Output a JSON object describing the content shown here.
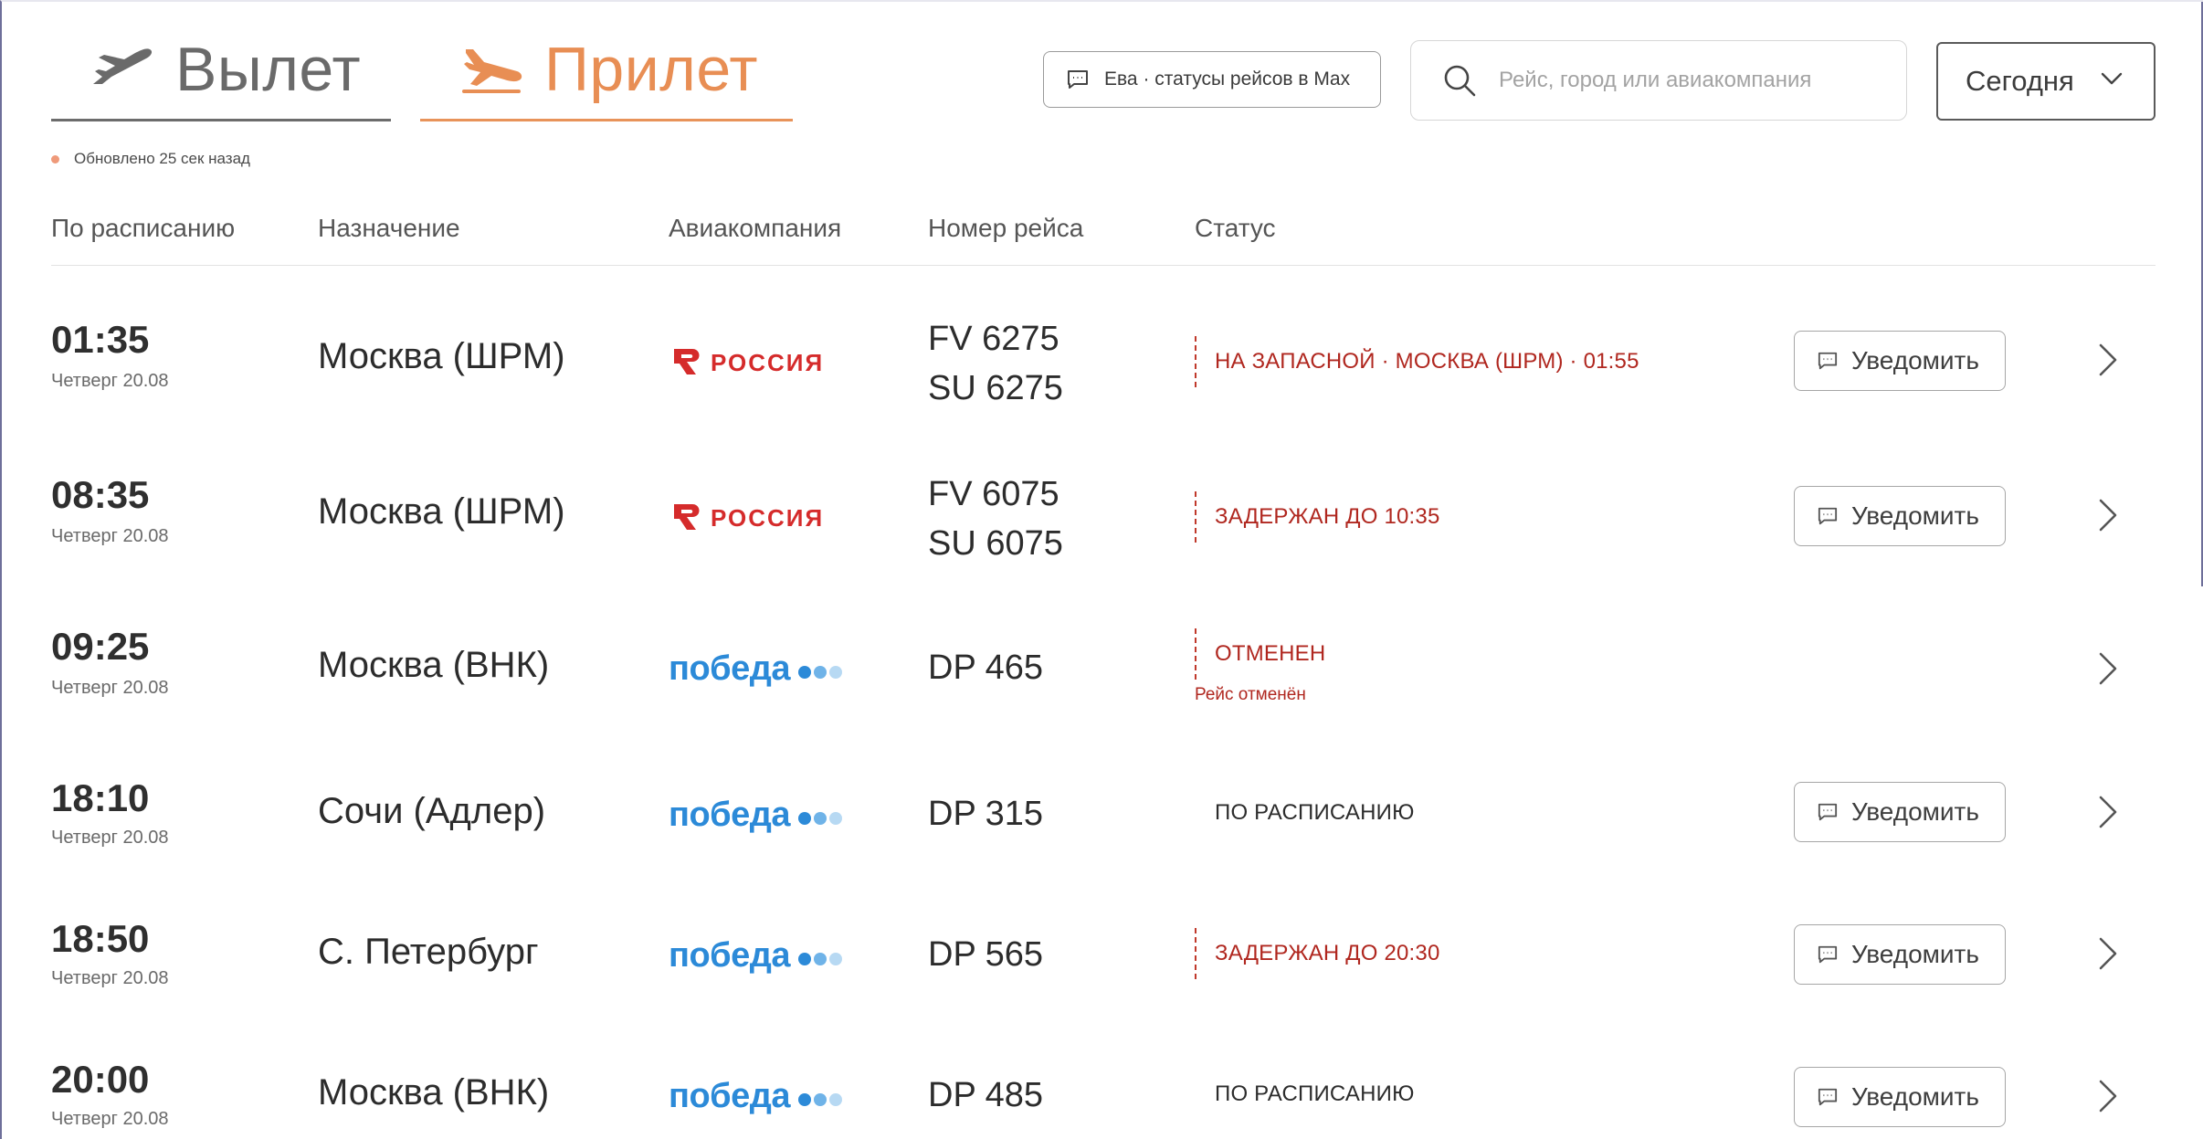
{
  "tabs": {
    "departure_label": "Вылет",
    "arrival_label": "Прилет",
    "active": "arrival"
  },
  "updated_text": "Обновлено 25 сек назад",
  "eva_button_label": "Ева · статусы рейсов в Max",
  "search": {
    "placeholder": "Рейс, город или авиакомпания",
    "value": ""
  },
  "date_select": {
    "value": "Сегодня"
  },
  "columns": {
    "scheduled": "По расписанию",
    "destination": "Назначение",
    "airline": "Авиакомпания",
    "flight_number": "Номер рейса",
    "status": "Статус"
  },
  "colors": {
    "accent": "#e88e54",
    "alert": "#b0271f",
    "rossiya_red": "#d52b2b",
    "pobeda_blue": "#2c8ad8"
  },
  "airline_logos": {
    "rossiya": "РОССИЯ",
    "pobeda": "победа"
  },
  "flights": [
    {
      "time": "01:35",
      "day": "Четверг 20.08",
      "destination": "Москва (ШРМ)",
      "airline_logo": "rossiya",
      "numbers": [
        "FV 6275",
        "SU 6275"
      ],
      "status": "НА ЗАПАСНОЙ · МОСКВА (ШРМ) · 01:55",
      "status_type": "alert",
      "note": "",
      "notify_label": "Уведомить"
    },
    {
      "time": "08:35",
      "day": "Четверг 20.08",
      "destination": "Москва (ШРМ)",
      "airline_logo": "rossiya",
      "numbers": [
        "FV 6075",
        "SU 6075"
      ],
      "status": "ЗАДЕРЖАН ДО 10:35",
      "status_type": "alert",
      "note": "",
      "notify_label": "Уведомить"
    },
    {
      "time": "09:25",
      "day": "Четверг 20.08",
      "destination": "Москва (ВНК)",
      "airline_logo": "pobeda",
      "numbers": [
        "DP 465"
      ],
      "status": "ОТМЕНЕН",
      "status_type": "alert",
      "note": "Рейс отменён",
      "notify_label": ""
    },
    {
      "time": "18:10",
      "day": "Четверг 20.08",
      "destination": "Сочи (Адлер)",
      "airline_logo": "pobeda",
      "numbers": [
        "DP 315"
      ],
      "status": "ПО РАСПИСАНИЮ",
      "status_type": "ok",
      "note": "",
      "notify_label": "Уведомить"
    },
    {
      "time": "18:50",
      "day": "Четверг 20.08",
      "destination": "С. Петербург",
      "airline_logo": "pobeda",
      "numbers": [
        "DP 565"
      ],
      "status": "ЗАДЕРЖАН ДО 20:30",
      "status_type": "alert",
      "note": "",
      "notify_label": "Уведомить"
    },
    {
      "time": "20:00",
      "day": "Четверг 20.08",
      "destination": "Москва (ВНК)",
      "airline_logo": "pobeda",
      "numbers": [
        "DP 485"
      ],
      "status": "ПО РАСПИСАНИЮ",
      "status_type": "ok",
      "note": "",
      "notify_label": "Уведомить"
    }
  ]
}
